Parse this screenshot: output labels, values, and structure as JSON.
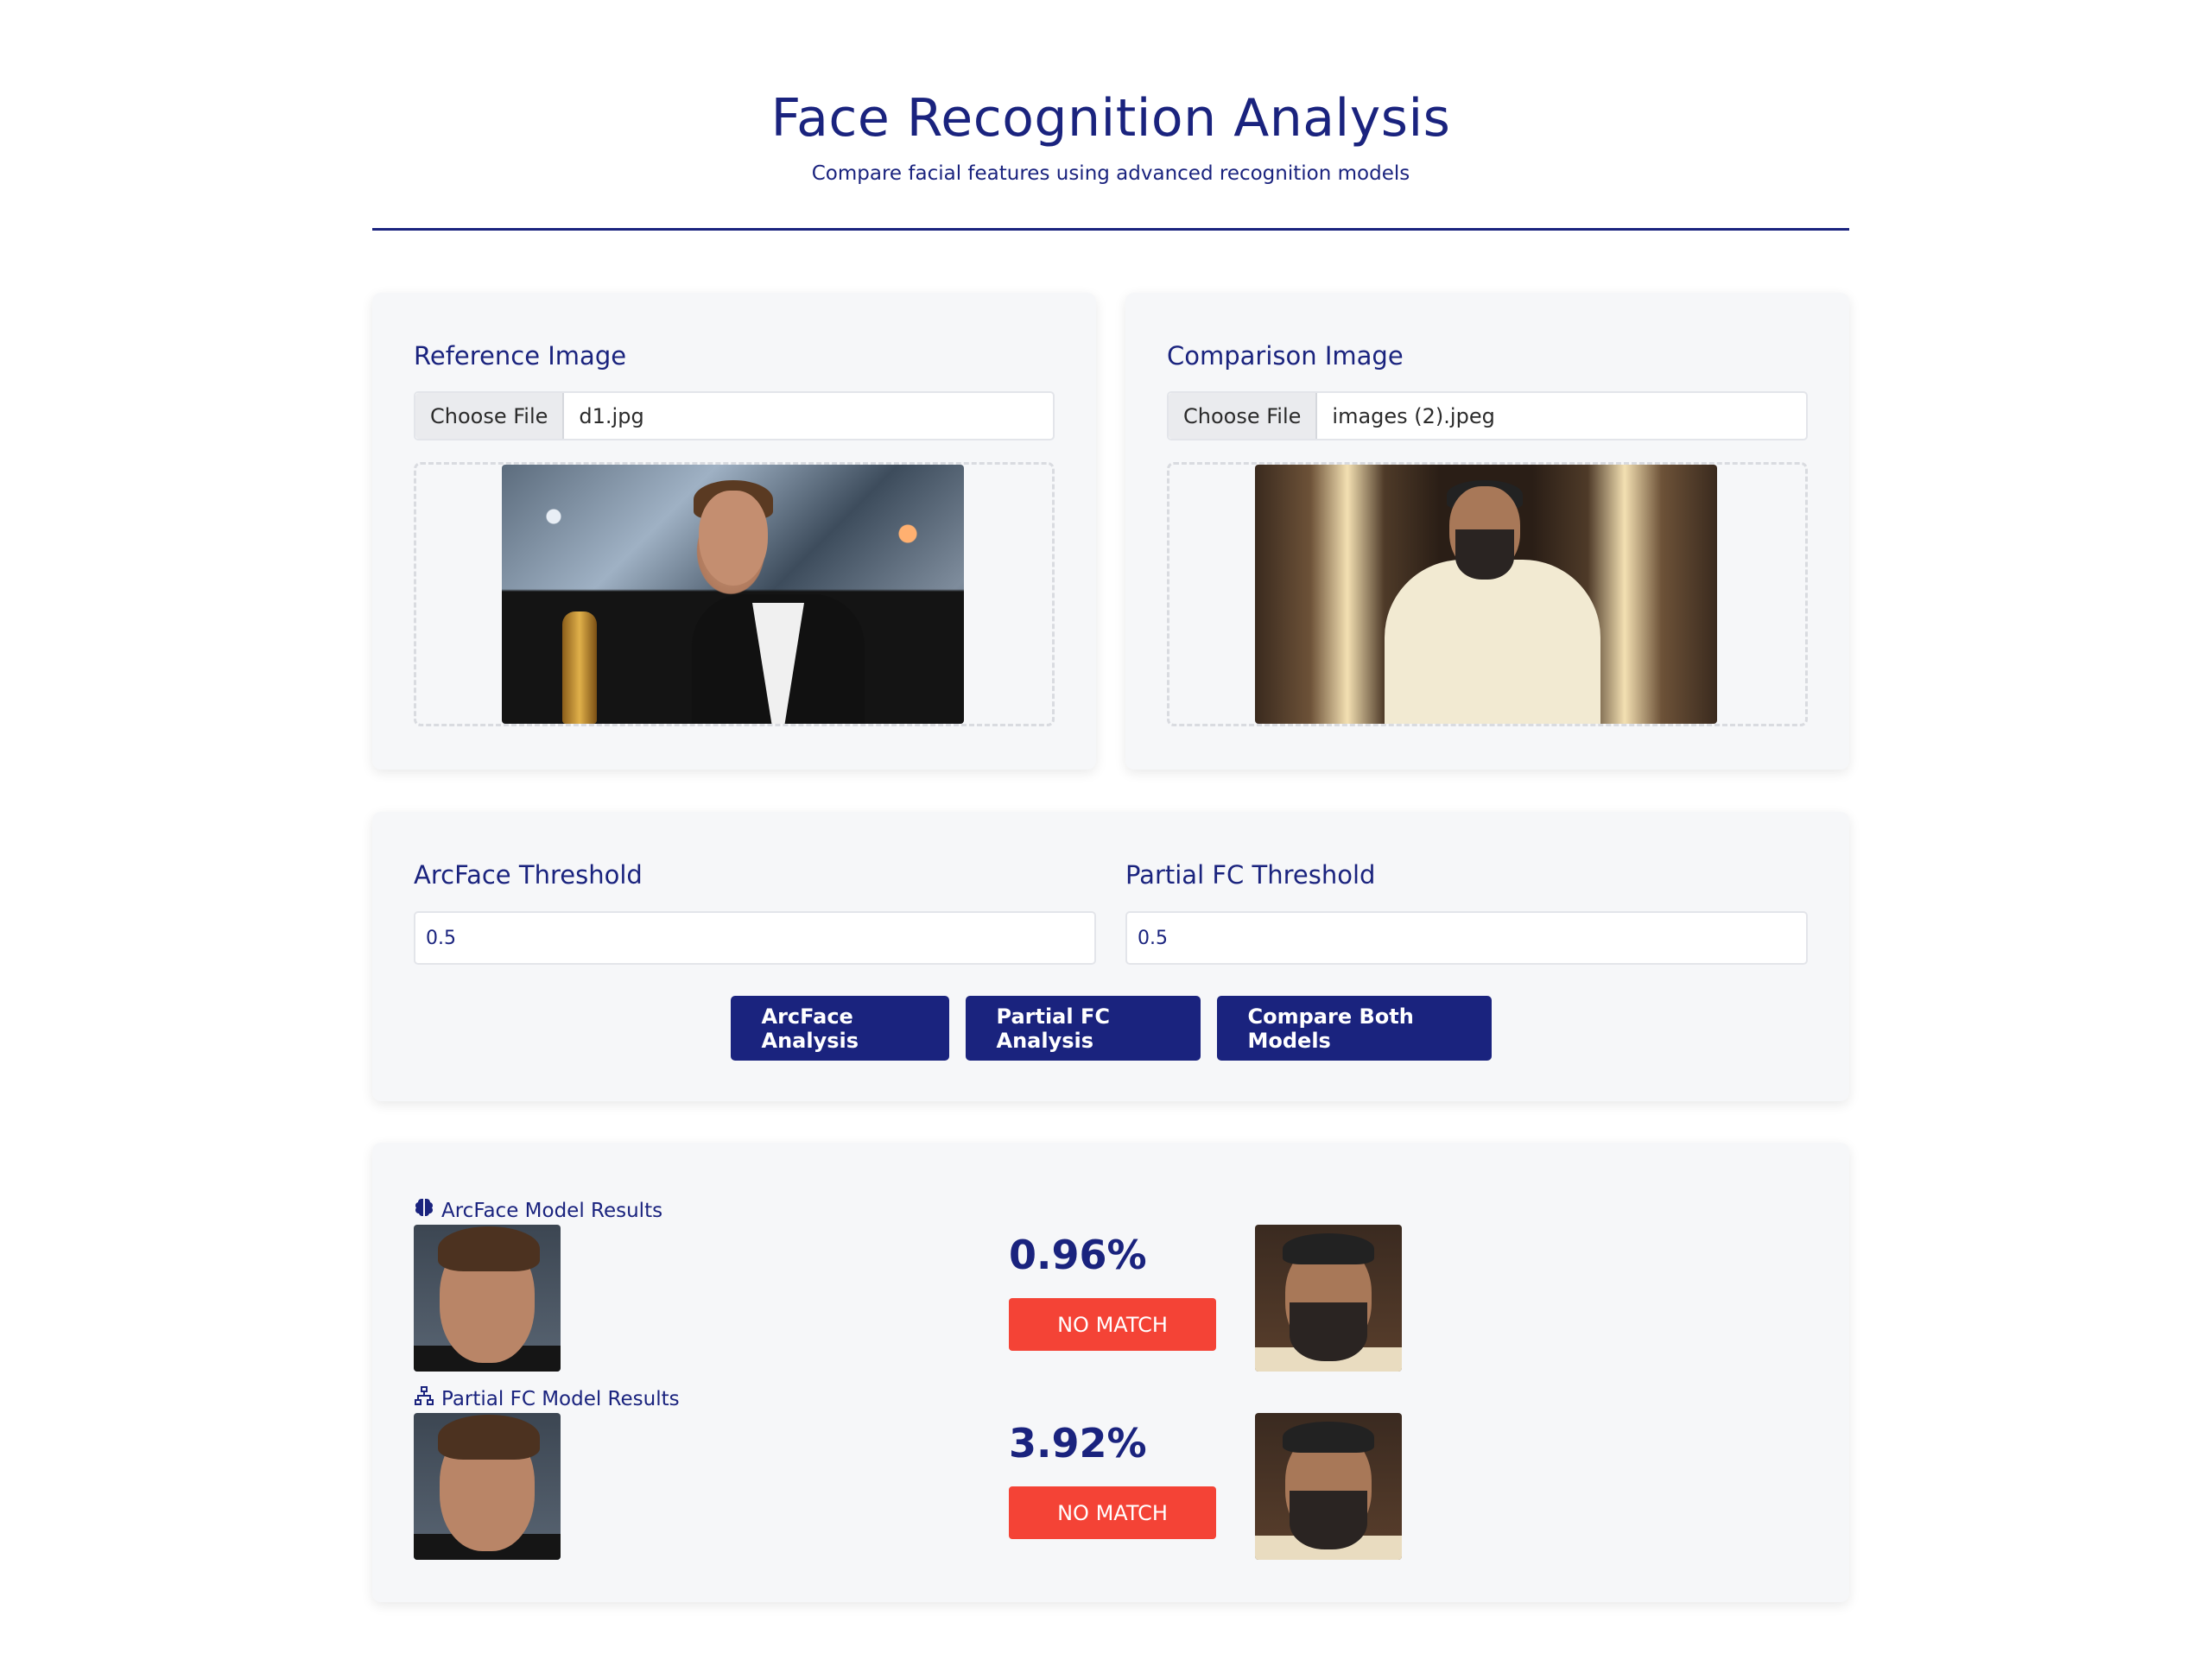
{
  "header": {
    "title": "Face Recognition Analysis",
    "subtitle": "Compare facial features using advanced recognition models"
  },
  "reference": {
    "label": "Reference Image",
    "choose_label": "Choose File",
    "file_name": "d1.jpg"
  },
  "comparison": {
    "label": "Comparison Image",
    "choose_label": "Choose File",
    "file_name": "images (2).jpeg"
  },
  "thresholds": {
    "arcface_label": "ArcFace Threshold",
    "arcface_value": "0.5",
    "partial_label": "Partial FC Threshold",
    "partial_value": "0.5"
  },
  "buttons": {
    "arcface": "ArcFace Analysis",
    "partial": "Partial FC Analysis",
    "compare": "Compare Both Models"
  },
  "results": {
    "arcface": {
      "heading": "ArcFace Model Results",
      "icon": "brain-icon",
      "score": "0.96%",
      "status": "NO MATCH"
    },
    "partial": {
      "heading": "Partial FC Model Results",
      "icon": "network-icon",
      "score": "3.92%",
      "status": "NO MATCH"
    }
  },
  "colors": {
    "primary": "#1a237e",
    "no_match": "#f44336",
    "card_bg": "#f6f7f9"
  }
}
